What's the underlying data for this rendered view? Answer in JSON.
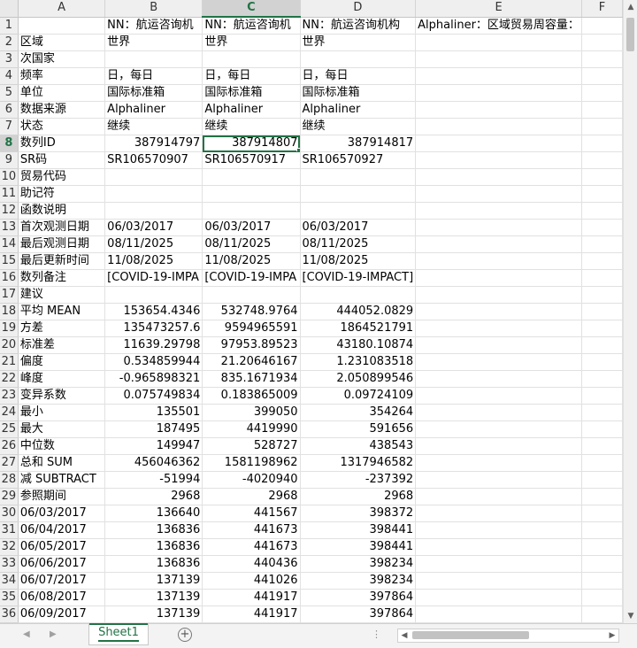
{
  "columns": [
    "A",
    "B",
    "C",
    "D",
    "E",
    "F"
  ],
  "selected_column": "C",
  "selected_row": 8,
  "rows": [
    {
      "n": "1",
      "a": "",
      "b": "NN：航运咨询机",
      "c": "NN：航运咨询机",
      "d": "NN：航运咨询机构",
      "e": "Alphaliner：区域贸易周容量：",
      "f": ""
    },
    {
      "n": "2",
      "a": "区域",
      "b": "世界",
      "c": "世界",
      "d": "世界",
      "e": "",
      "f": ""
    },
    {
      "n": "3",
      "a": "次国家",
      "b": "",
      "c": "",
      "d": "",
      "e": "",
      "f": ""
    },
    {
      "n": "4",
      "a": "频率",
      "b": "日，每日",
      "c": "日，每日",
      "d": "日，每日",
      "e": "",
      "f": ""
    },
    {
      "n": "5",
      "a": "单位",
      "b": "国际标准箱",
      "c": "国际标准箱",
      "d": "国际标准箱",
      "e": "",
      "f": ""
    },
    {
      "n": "6",
      "a": "数据来源",
      "b": "Alphaliner",
      "c": "Alphaliner",
      "d": "Alphaliner",
      "e": "",
      "f": ""
    },
    {
      "n": "7",
      "a": "状态",
      "b": "继续",
      "c": "继续",
      "d": "继续",
      "e": "",
      "f": ""
    },
    {
      "n": "8",
      "a": "数列ID",
      "b": "387914797",
      "c": "387914807",
      "d": "387914817",
      "e": "",
      "f": ""
    },
    {
      "n": "9",
      "a": "SR码",
      "b": "SR106570907",
      "c": "SR106570917",
      "d": "SR106570927",
      "e": "",
      "f": ""
    },
    {
      "n": "10",
      "a": "贸易代码",
      "b": "",
      "c": "",
      "d": "",
      "e": "",
      "f": ""
    },
    {
      "n": "11",
      "a": "助记符",
      "b": "",
      "c": "",
      "d": "",
      "e": "",
      "f": ""
    },
    {
      "n": "12",
      "a": "函数说明",
      "b": "",
      "c": "",
      "d": "",
      "e": "",
      "f": ""
    },
    {
      "n": "13",
      "a": "首次观测日期",
      "b": "06/03/2017",
      "c": "06/03/2017",
      "d": "06/03/2017",
      "e": "",
      "f": ""
    },
    {
      "n": "14",
      "a": "最后观测日期",
      "b": "08/11/2025",
      "c": "08/11/2025",
      "d": "08/11/2025",
      "e": "",
      "f": ""
    },
    {
      "n": "15",
      "a": "最后更新时间",
      "b": "11/08/2025",
      "c": "11/08/2025",
      "d": "11/08/2025",
      "e": "",
      "f": ""
    },
    {
      "n": "16",
      "a": "数列备注",
      "b": "[COVID-19-IMPA",
      "c": "[COVID-19-IMPA",
      "d": "[COVID-19-IMPACT]",
      "e": "",
      "f": ""
    },
    {
      "n": "17",
      "a": "建议",
      "b": "",
      "c": "",
      "d": "",
      "e": "",
      "f": ""
    },
    {
      "n": "18",
      "a": "平均 MEAN",
      "b": "153654.4346",
      "c": "532748.9764",
      "d": "444052.0829",
      "e": "",
      "f": ""
    },
    {
      "n": "19",
      "a": "方差",
      "b": "135473257.6",
      "c": "9594965591",
      "d": "1864521791",
      "e": "",
      "f": ""
    },
    {
      "n": "20",
      "a": "标准差",
      "b": "11639.29798",
      "c": "97953.89523",
      "d": "43180.10874",
      "e": "",
      "f": ""
    },
    {
      "n": "21",
      "a": "偏度",
      "b": "0.534859944",
      "c": "21.20646167",
      "d": "1.231083518",
      "e": "",
      "f": ""
    },
    {
      "n": "22",
      "a": "峰度",
      "b": "-0.965898321",
      "c": "835.1671934",
      "d": "2.050899546",
      "e": "",
      "f": ""
    },
    {
      "n": "23",
      "a": "变异系数",
      "b": "0.075749834",
      "c": "0.183865009",
      "d": "0.09724109",
      "e": "",
      "f": ""
    },
    {
      "n": "24",
      "a": "最小",
      "b": "135501",
      "c": "399050",
      "d": "354264",
      "e": "",
      "f": ""
    },
    {
      "n": "25",
      "a": "最大",
      "b": "187495",
      "c": "4419990",
      "d": "591656",
      "e": "",
      "f": ""
    },
    {
      "n": "26",
      "a": "中位数",
      "b": "149947",
      "c": "528727",
      "d": "438543",
      "e": "",
      "f": ""
    },
    {
      "n": "27",
      "a": "总和 SUM",
      "b": "456046362",
      "c": "1581198962",
      "d": "1317946582",
      "e": "",
      "f": ""
    },
    {
      "n": "28",
      "a": "减 SUBTRACT",
      "b": "-51994",
      "c": "-4020940",
      "d": "-237392",
      "e": "",
      "f": ""
    },
    {
      "n": "29",
      "a": "参照期间",
      "b": "2968",
      "c": "2968",
      "d": "2968",
      "e": "",
      "f": ""
    },
    {
      "n": "30",
      "a": "06/03/2017",
      "b": "136640",
      "c": "441567",
      "d": "398372",
      "e": "",
      "f": ""
    },
    {
      "n": "31",
      "a": "06/04/2017",
      "b": "136836",
      "c": "441673",
      "d": "398441",
      "e": "",
      "f": ""
    },
    {
      "n": "32",
      "a": "06/05/2017",
      "b": "136836",
      "c": "441673",
      "d": "398441",
      "e": "",
      "f": ""
    },
    {
      "n": "33",
      "a": "06/06/2017",
      "b": "136836",
      "c": "440436",
      "d": "398234",
      "e": "",
      "f": ""
    },
    {
      "n": "34",
      "a": "06/07/2017",
      "b": "137139",
      "c": "441026",
      "d": "398234",
      "e": "",
      "f": ""
    },
    {
      "n": "35",
      "a": "06/08/2017",
      "b": "137139",
      "c": "441917",
      "d": "397864",
      "e": "",
      "f": ""
    },
    {
      "n": "36",
      "a": "06/09/2017",
      "b": "137139",
      "c": "441917",
      "d": "397864",
      "e": "",
      "f": ""
    }
  ],
  "sheet_tab": "Sheet1",
  "add_sheet_symbol": "+",
  "dots": "⋮",
  "colors": {
    "accent": "#217346",
    "header_bg": "#efefef",
    "grid": "#e1e1e1"
  }
}
